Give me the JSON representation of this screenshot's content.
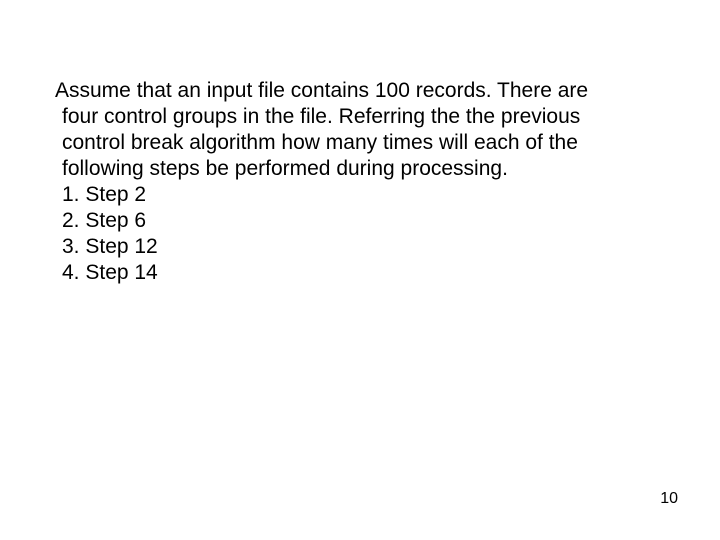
{
  "slide": {
    "intro": "Assume that an input file contains 100 records.  There are four control groups in the file.  Referring the the previous control break algorithm how many times will each of the following steps be performed during processing.",
    "items": [
      "1. Step 2",
      "2. Step 6",
      "3. Step 12",
      "4. Step 14"
    ],
    "page_number": "10"
  }
}
